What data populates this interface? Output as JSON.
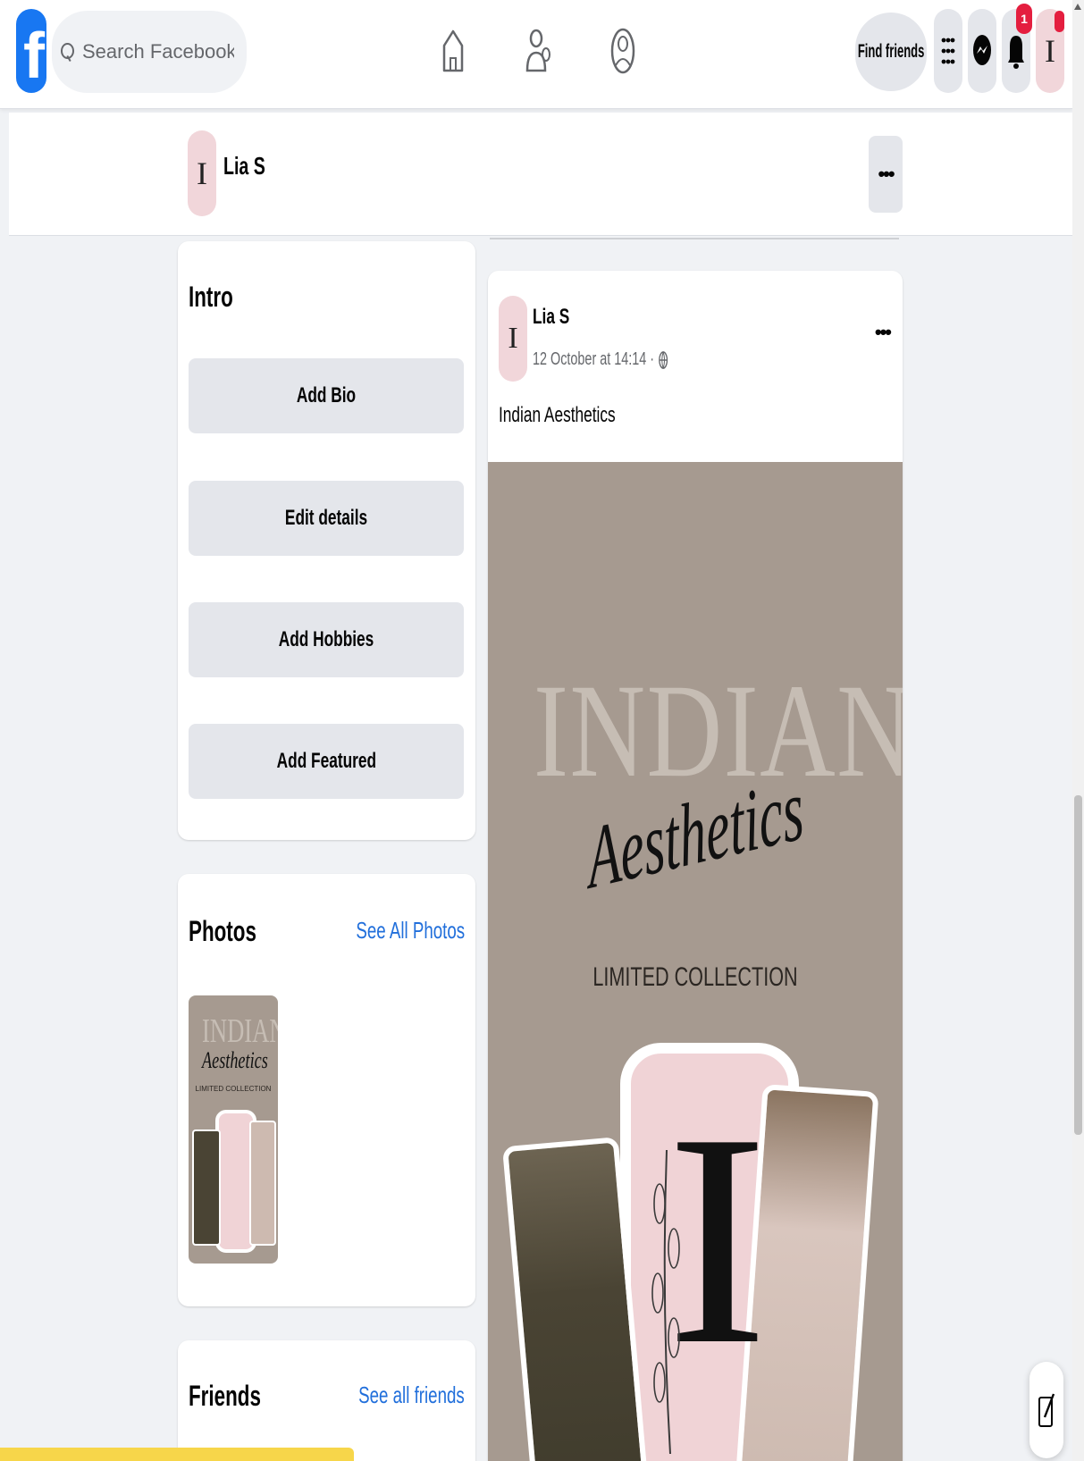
{
  "nav": {
    "search_placeholder": "Search Facebook",
    "find_friends": "Find friends",
    "notification_count": "1",
    "avatar_letter": "I"
  },
  "profile": {
    "name": "Lia S",
    "avatar_letter": "I",
    "more": "•••"
  },
  "intro": {
    "title": "Intro",
    "buttons": [
      "Add Bio",
      "Edit details",
      "Add Hobbies",
      "Add Featured"
    ]
  },
  "photos": {
    "title": "Photos",
    "link": "See All Photos"
  },
  "friends": {
    "title": "Friends",
    "link": "See all friends"
  },
  "post": {
    "author": "Lia S",
    "timestamp": "12 October at 14:14 ·",
    "text": "Indian Aesthetics",
    "more": "•••",
    "image": {
      "headline": "INDIAN",
      "script": "Aesthetics",
      "subline": "LIMITED COLLECTION",
      "letter": "I"
    }
  },
  "colors": {
    "brand": "#1877f2",
    "link": "#216fdb",
    "badge": "#e41e3f",
    "background": "#f0f2f5"
  },
  "icons": [
    "facebook-logo-icon",
    "search-icon",
    "home-icon",
    "friends-icon",
    "groups-icon",
    "menu-grid-icon",
    "messenger-icon",
    "bell-icon",
    "globe-icon",
    "compose-icon"
  ]
}
